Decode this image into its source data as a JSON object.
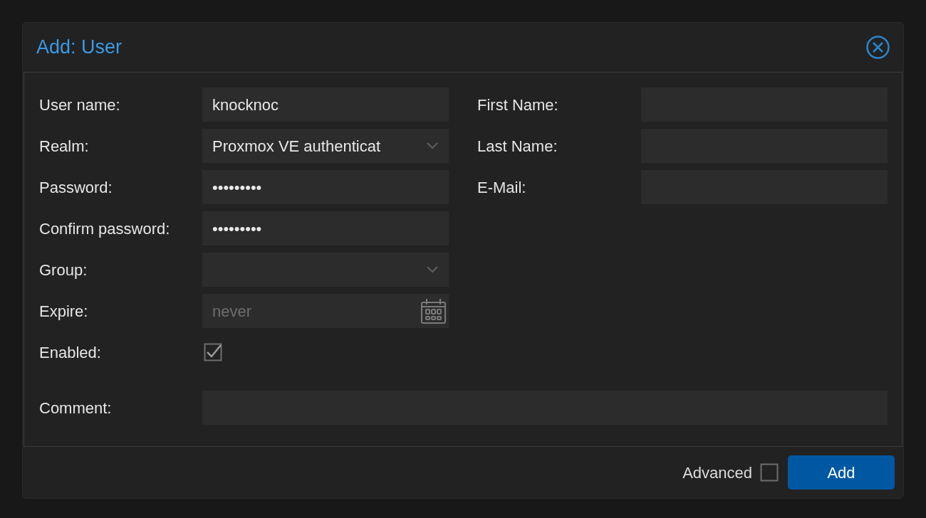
{
  "dialog": {
    "title": "Add: User"
  },
  "left_fields": [
    {
      "label": "User name:",
      "kind": "text",
      "value": "knocknoc"
    },
    {
      "label": "Realm:",
      "kind": "select",
      "value": "Proxmox VE authenticat"
    },
    {
      "label": "Password:",
      "kind": "text",
      "value": "•••••••••"
    },
    {
      "label": "Confirm password:",
      "kind": "text",
      "value": "•••••••••"
    },
    {
      "label": "Group:",
      "kind": "select"
    },
    {
      "label": "Expire:",
      "kind": "date",
      "placeholder": "never"
    },
    {
      "label": "Enabled:",
      "kind": "checkbox",
      "checked": true
    }
  ],
  "right_fields": [
    {
      "label": "First Name:",
      "kind": "text"
    },
    {
      "label": "Last Name:",
      "kind": "text"
    },
    {
      "label": "E-Mail:",
      "kind": "text"
    }
  ],
  "comment": {
    "label": "Comment:",
    "kind": "text"
  },
  "footer": {
    "advanced": {
      "label": "Advanced",
      "checked": false
    },
    "button": "Add"
  }
}
